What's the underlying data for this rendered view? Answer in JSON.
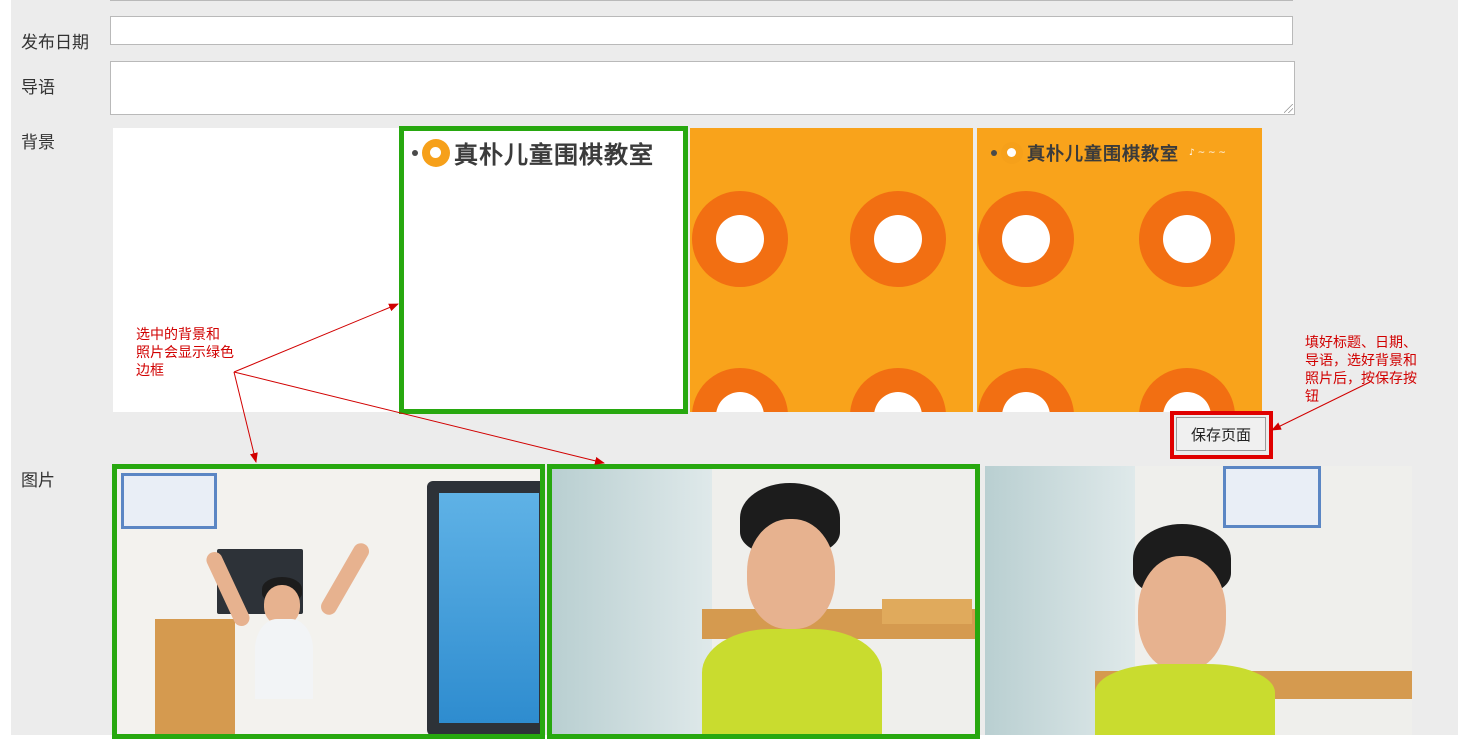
{
  "form": {
    "date_label": "发布日期",
    "intro_label": "导语",
    "background_label": "背景",
    "images_label": "图片",
    "date_value": "",
    "intro_value": ""
  },
  "backgrounds": [
    {
      "style": "blank",
      "selected": false
    },
    {
      "style": "logo-white",
      "selected": true,
      "logo_text": "真朴儿童围棋教室"
    },
    {
      "style": "orange-rings",
      "selected": false
    },
    {
      "style": "orange-logo-rings",
      "selected": false,
      "logo_text": "真朴儿童围棋教室"
    }
  ],
  "photos": [
    {
      "subject": "boy-raising-arms-by-screen",
      "selected": true
    },
    {
      "subject": "boy-looking-down",
      "selected": true
    },
    {
      "subject": "boy-eyes-closed",
      "selected": false
    }
  ],
  "save_button": {
    "label": "保存页面"
  },
  "annotations": {
    "selection_note": [
      "选中的背景和",
      "照片会显示绿色",
      "边框"
    ],
    "save_note": [
      "填好标题、日期、",
      "导语，选好背景和",
      "照片后，按保存按",
      "钮"
    ]
  },
  "colors": {
    "selected_border": "#27a80f",
    "annotation": "#d10000",
    "highlight": "#e00000",
    "orange": "#f9a31b",
    "ring": "#f26f12"
  }
}
